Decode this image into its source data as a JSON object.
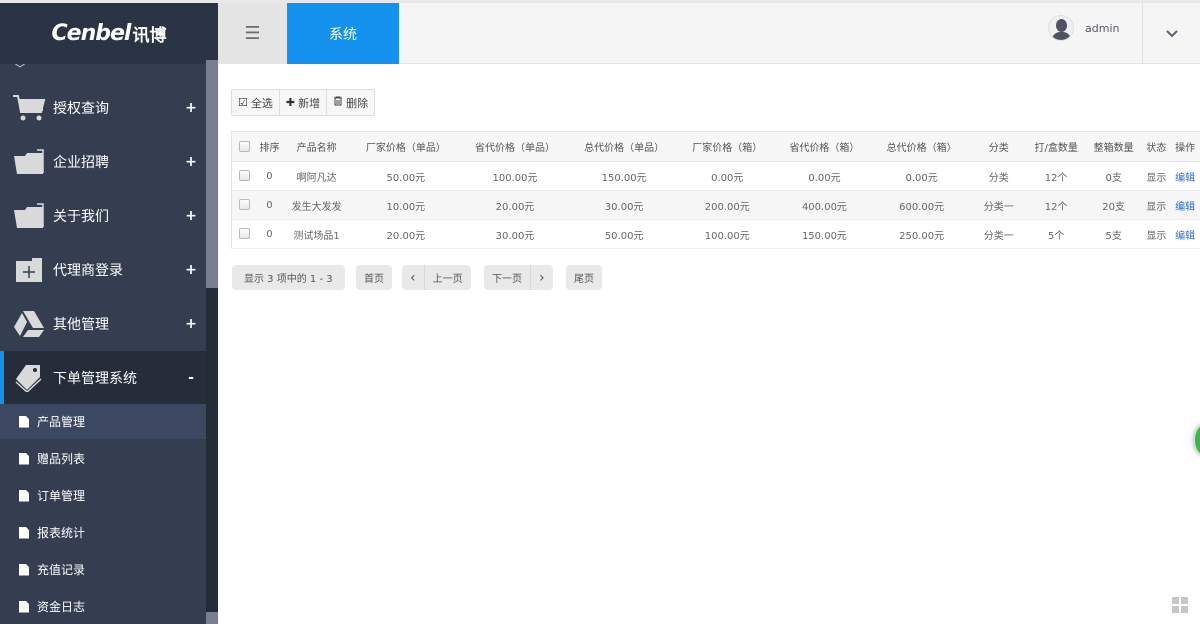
{
  "brand": {
    "logo_text": "Cenbel",
    "logo_cn": "讯博"
  },
  "header": {
    "menu_icon": "hamburger-icon",
    "active_tab": "系统",
    "username": "admin",
    "dropdown_icon": "chevron-down-icon",
    "accent_color": "#1591ee"
  },
  "sidebar": {
    "items": [
      {
        "label": "授权查询",
        "icon": "cart-icon",
        "sign": "+"
      },
      {
        "label": "企业招聘",
        "icon": "folder-icon",
        "sign": "+"
      },
      {
        "label": "关于我们",
        "icon": "folder-icon",
        "sign": "+"
      },
      {
        "label": "代理商登录",
        "icon": "folder-plus-icon",
        "sign": "+"
      },
      {
        "label": "其他管理",
        "icon": "drive-icon",
        "sign": "+"
      },
      {
        "label": "下单管理系统",
        "icon": "tags-icon",
        "sign": "-",
        "active": true
      }
    ],
    "subitems": [
      {
        "label": "产品管理",
        "active": true
      },
      {
        "label": "赠品列表"
      },
      {
        "label": "订单管理"
      },
      {
        "label": "报表统计"
      },
      {
        "label": "充值记录"
      },
      {
        "label": "资金日志"
      }
    ]
  },
  "toolbar": {
    "select_all": "全选",
    "add": "新增",
    "delete": "删除"
  },
  "table": {
    "headers": [
      "排序",
      "产品名称",
      "厂家价格（单品）",
      "省代价格（单品）",
      "总代价格（单品）",
      "厂家价格（箱）",
      "省代价格（箱）",
      "总代价格（箱）",
      "分类",
      "打/盒数量",
      "整箱数量",
      "状态",
      "操作"
    ],
    "rows": [
      [
        "0",
        "啊阿凡达",
        "50.00元",
        "100.00元",
        "150.00元",
        "0.00元",
        "0.00元",
        "0.00元",
        "分类",
        "12个",
        "0支",
        "显示",
        "编辑"
      ],
      [
        "0",
        "发生大发发",
        "10.00元",
        "20.00元",
        "30.00元",
        "200.00元",
        "400.00元",
        "600.00元",
        "分类一",
        "12个",
        "20支",
        "显示",
        "编辑"
      ],
      [
        "0",
        "测试场品1",
        "20.00元",
        "30.00元",
        "50.00元",
        "100.00元",
        "150.00元",
        "250.00元",
        "分类一",
        "5个",
        "5支",
        "显示",
        "编辑"
      ]
    ]
  },
  "pagination": {
    "info": "显示 3 项中的 1 - 3",
    "first": "首页",
    "prev": "上一页",
    "next": "下一页",
    "last": "尾页"
  }
}
